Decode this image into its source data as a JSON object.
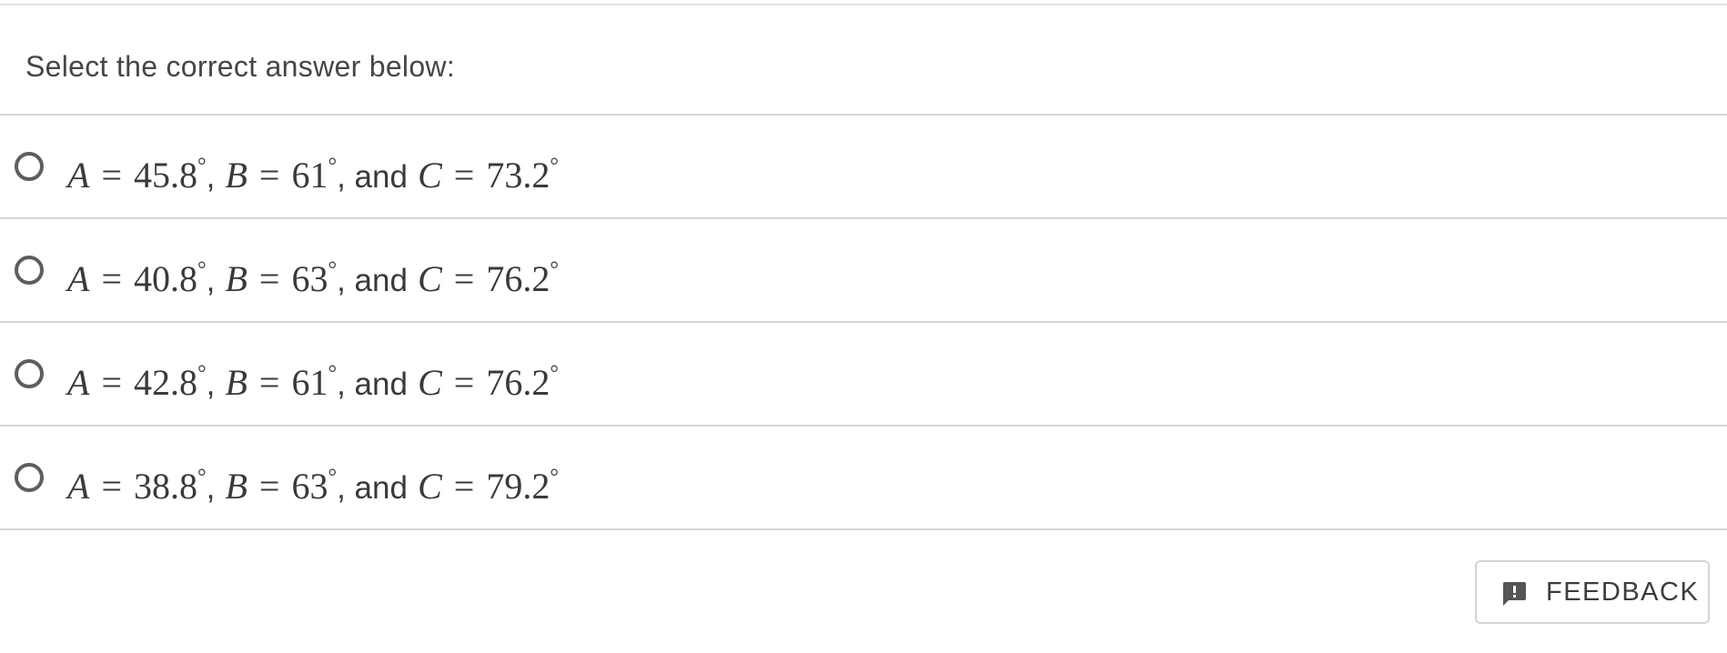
{
  "prompt": "Select the correct answer below:",
  "options": [
    {
      "a_var": "A",
      "a_val": "45.8",
      "b_var": "B",
      "b_val": "61",
      "sep1": ",",
      "sep2": ", and",
      "c_var": "C",
      "c_val": "73.2",
      "eq": "=",
      "deg": "°"
    },
    {
      "a_var": "A",
      "a_val": "40.8",
      "b_var": "B",
      "b_val": "63",
      "sep1": ",",
      "sep2": ", and",
      "c_var": "C",
      "c_val": "76.2",
      "eq": "=",
      "deg": "°"
    },
    {
      "a_var": "A",
      "a_val": "42.8",
      "b_var": "B",
      "b_val": "61",
      "sep1": ",",
      "sep2": ", and",
      "c_var": "C",
      "c_val": "76.2",
      "eq": "=",
      "deg": "°"
    },
    {
      "a_var": "A",
      "a_val": "38.8",
      "b_var": "B",
      "b_val": "63",
      "sep1": ",",
      "sep2": ", and",
      "c_var": "C",
      "c_val": "79.2",
      "eq": "=",
      "deg": "°"
    }
  ],
  "feedback": {
    "label": "FEEDBACK",
    "icon": "feedback-icon",
    "icon_color": "#555555"
  },
  "colors": {
    "text": "#404040",
    "divider": "#d6d6d6",
    "radio_border": "#5e5e5e"
  }
}
